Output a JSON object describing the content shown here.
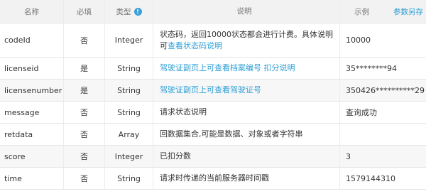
{
  "header": {
    "name": "名称",
    "required": "必填",
    "type": "类型",
    "type_info_icon": "info-icon",
    "description": "说明",
    "example": "示例",
    "save_link": "参数另存"
  },
  "rows": [
    {
      "name": "codeId",
      "required": "否",
      "type": "Integer",
      "desc_text": "状态码，返回10000状态都会进行计费。具体说明可",
      "desc_link": "查看状态码说明",
      "example": "10000"
    },
    {
      "name": "licenseid",
      "required": "是",
      "type": "String",
      "desc_text": "",
      "desc_link": "驾驶证副页上可查看档案编号 扣分说明",
      "example": "35********94"
    },
    {
      "name": "licensenumber",
      "required": "是",
      "type": "String",
      "desc_text": "",
      "desc_link": "驾驶证副页上可查看驾驶证号",
      "example": "350426**********29"
    },
    {
      "name": "message",
      "required": "否",
      "type": "String",
      "desc_text": "请求状态说明",
      "desc_link": "",
      "example": "查询成功"
    },
    {
      "name": "retdata",
      "required": "否",
      "type": "Array",
      "desc_text": "回数据集合,可能是数据、对象或者字符串",
      "desc_link": "",
      "example": ""
    },
    {
      "name": "score",
      "required": "否",
      "type": "Integer",
      "desc_text": "已扣分数",
      "desc_link": "",
      "example": "3"
    },
    {
      "name": "time",
      "required": "否",
      "type": "String",
      "desc_text": "请求时传递的当前服务器时间戳",
      "desc_link": "",
      "example": "1579144310"
    }
  ]
}
